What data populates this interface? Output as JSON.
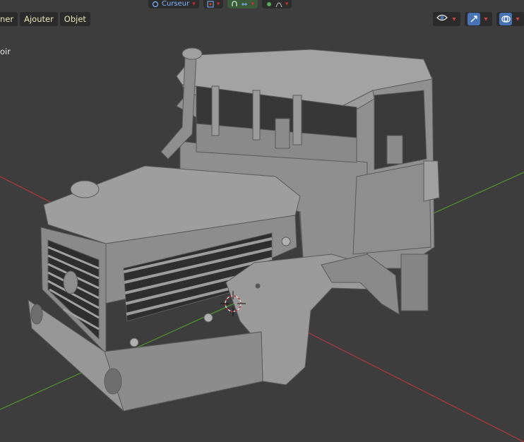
{
  "menubar": {
    "partial_item": "ner",
    "add": "Ajouter",
    "object": "Objet"
  },
  "header_tools": {
    "transform_pivot": "Curseur"
  },
  "viewport": {
    "partial_overlay_text": "oir"
  },
  "colors": {
    "background": "#3d3d3d",
    "x_axis": "#a83a3a",
    "y_axis": "#4f8f2f",
    "mesh": "#9a9a9a",
    "menu_text": "#e6e6b4",
    "active_button": "#4772b3"
  },
  "icons": [
    "pivot-icon",
    "snap-icon",
    "proportional-edit-icon",
    "visibility-icon",
    "gizmo-icon",
    "overlay-icon",
    "3d-cursor-icon"
  ]
}
